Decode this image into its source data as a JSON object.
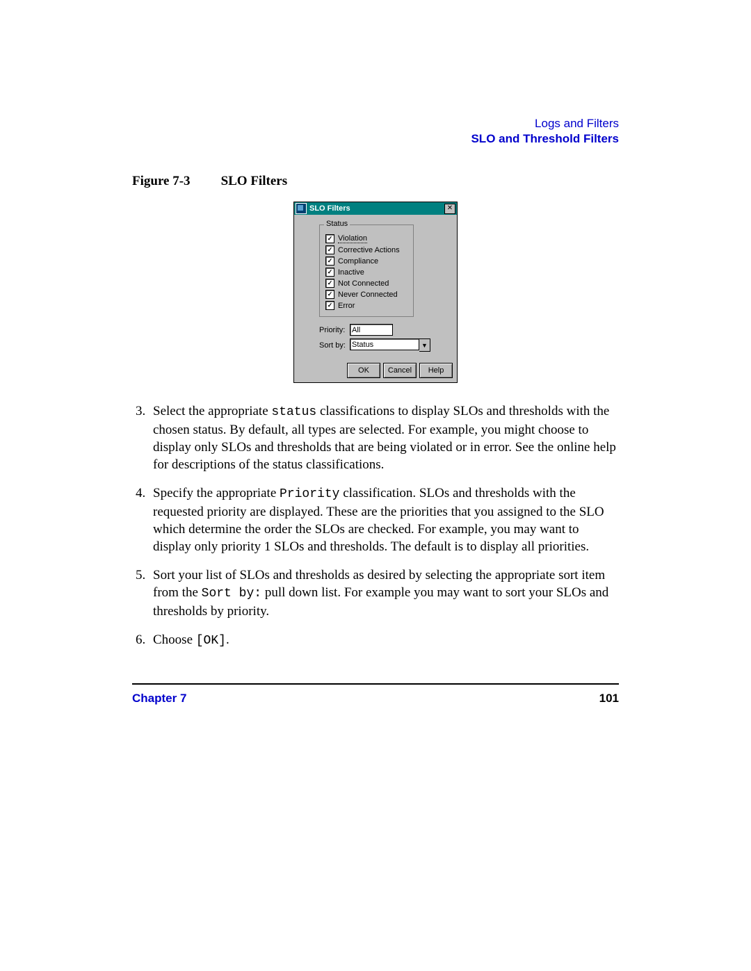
{
  "header": {
    "section": "Logs and Filters",
    "subsection": "SLO and Threshold Filters"
  },
  "figure": {
    "label": "Figure 7-3",
    "title": "SLO Filters"
  },
  "dialog": {
    "title": "SLO Filters",
    "status_legend": "Status",
    "checks": {
      "violation": "Violation",
      "corrective": "Corrective Actions",
      "compliance": "Compliance",
      "inactive": "Inactive",
      "notconn": "Not Connected",
      "neverconn": "Never Connected",
      "error": "Error"
    },
    "priority_label": "Priority:",
    "priority_value": "All",
    "sortby_label": "Sort by:",
    "sortby_value": "Status",
    "buttons": {
      "ok": "OK",
      "cancel": "Cancel",
      "help": "Help"
    }
  },
  "steps": {
    "s3_a": "Select the appropriate ",
    "s3_code": "status",
    "s3_b": " classifications to display SLOs and thresholds with the chosen status. By default, all types are selected. For example, you might choose to display only SLOs and thresholds that are being violated or in error. See the online help for descriptions of the status classifications.",
    "s4_a": "Specify the appropriate ",
    "s4_code": "Priority",
    "s4_b": " classification. SLOs and thresholds with the requested priority are displayed. These are the priorities that you assigned to the SLO which determine the order the SLOs are checked. For example, you may want to display only priority 1 SLOs and thresholds. The default is to display all priorities.",
    "s5_a": "Sort your list of SLOs and thresholds as desired by selecting the appropriate sort item from the ",
    "s5_code": "Sort by:",
    "s5_b": " pull down list. For example you may want to sort your SLOs and thresholds by priority.",
    "s6_a": "Choose ",
    "s6_code": "[OK]",
    "s6_b": "."
  },
  "footer": {
    "chapter": "Chapter 7",
    "page": "101"
  }
}
